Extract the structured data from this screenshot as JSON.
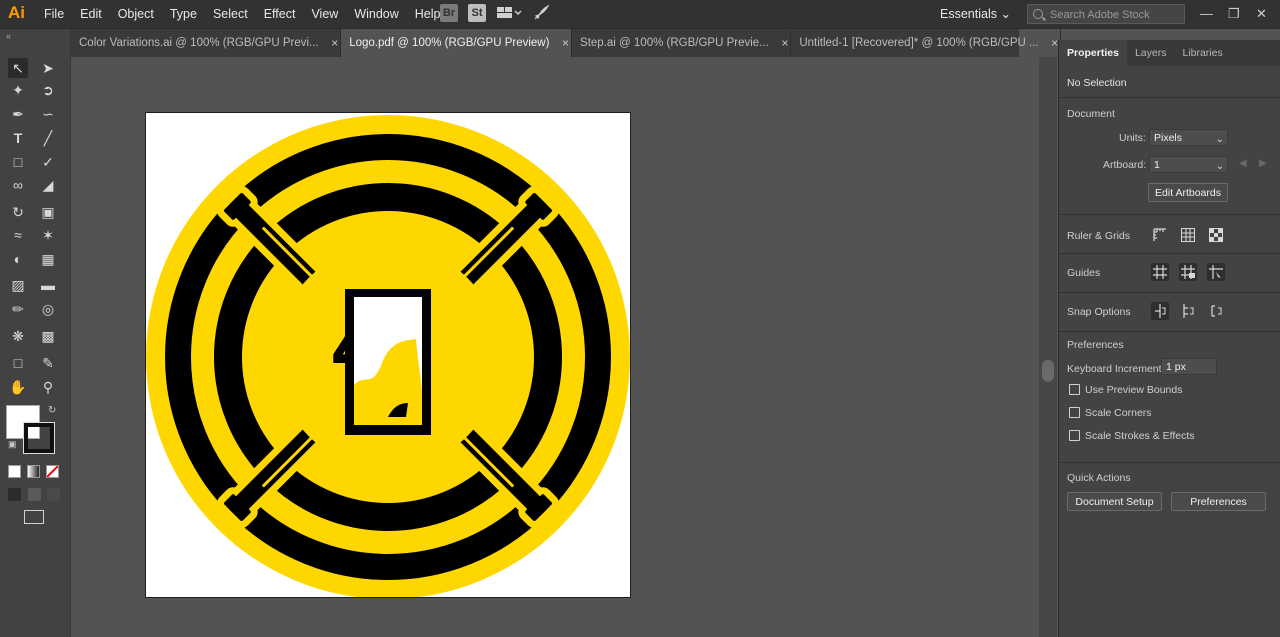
{
  "app": {
    "logo": "Ai"
  },
  "menu": [
    "File",
    "Edit",
    "Object",
    "Type",
    "Select",
    "Effect",
    "View",
    "Window",
    "Help"
  ],
  "toolbar_icons": {
    "bridge": "Br",
    "stock": "St"
  },
  "workspace": {
    "label": "Essentials"
  },
  "search": {
    "placeholder": "Search Adobe Stock"
  },
  "tabs": [
    {
      "label": "Color Variations.ai @ 100% (RGB/GPU Previ...",
      "active": false
    },
    {
      "label": "Logo.pdf @ 100% (RGB/GPU Preview)",
      "active": true
    },
    {
      "label": "Step.ai @ 100% (RGB/GPU Previe...",
      "active": false
    },
    {
      "label": "Untitled-1 [Recovered]* @ 100% (RGB/GPU ...",
      "active": false
    }
  ],
  "panel": {
    "tabs": [
      "Properties",
      "Layers",
      "Libraries"
    ],
    "selection": "No Selection",
    "document": {
      "title": "Document",
      "units_label": "Units:",
      "units_value": "Pixels",
      "artboard_label": "Artboard:",
      "artboard_value": "1",
      "edit_artboards": "Edit Artboards"
    },
    "ruler_grids": "Ruler & Grids",
    "guides": "Guides",
    "snap_options": "Snap Options",
    "preferences": {
      "title": "Preferences",
      "keyboard_increment_label": "Keyboard Increment:",
      "keyboard_increment_value": "1 px",
      "use_preview_bounds": "Use Preview Bounds",
      "scale_corners": "Scale Corners",
      "scale_strokes": "Scale Strokes & Effects"
    },
    "quick_actions": {
      "title": "Quick Actions",
      "document_setup": "Document Setup",
      "preferences_button": "Preferences"
    }
  },
  "artwork": {
    "digit": "4"
  },
  "colors": {
    "brand_yellow": "#FFD700",
    "logo_black": "#000000",
    "app_orange": "#FF9A00"
  }
}
